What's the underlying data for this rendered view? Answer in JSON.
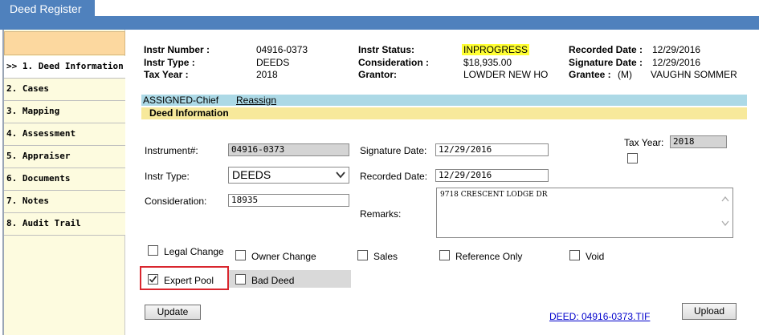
{
  "app": {
    "tab_title": "Deed Register"
  },
  "sidebar": {
    "items": [
      {
        "label": ">> 1. Deed Information"
      },
      {
        "label": "2. Cases"
      },
      {
        "label": "3. Mapping"
      },
      {
        "label": "4. Assessment"
      },
      {
        "label": "5. Appraiser"
      },
      {
        "label": "6. Documents"
      },
      {
        "label": "7. Notes"
      },
      {
        "label": "8. Audit Trail"
      }
    ]
  },
  "summary": {
    "instr_number_label": "Instr Number :",
    "instr_number": "04916-0373",
    "instr_type_label": "Instr Type :",
    "instr_type": "DEEDS",
    "tax_year_label": "Tax Year :",
    "tax_year": "2018",
    "instr_status_label": "Instr Status:",
    "instr_status": "INPROGRESS",
    "consideration_label": "Consideration :",
    "consideration": "$18,935.00",
    "grantor_label": "Grantor:",
    "grantor": "LOWDER NEW HO",
    "recorded_date_label": "Recorded Date :",
    "recorded_date": "12/29/2016",
    "signature_date_label": "Signature Date :",
    "signature_date": "12/29/2016",
    "grantee_label": "Grantee :",
    "grantee_flag": "(M)",
    "grantee": "VAUGHN SOMMER"
  },
  "assignment": {
    "assigned": "ASSIGNED-Chief",
    "reassign": "Reassign"
  },
  "section": {
    "title": "Deed Information"
  },
  "form": {
    "instrument_label": "Instrument#:",
    "instrument_value": "04916-0373",
    "instr_type_label": "Instr Type:",
    "instr_type_value": "DEEDS",
    "consideration_label": "Consideration:",
    "consideration_value": "18935",
    "signature_date_label": "Signature Date:",
    "signature_date_value": "12/29/2016",
    "recorded_date_label": "Recorded Date:",
    "recorded_date_value": "12/29/2016",
    "remarks_label": "Remarks:",
    "remarks_value": "9718 CRESCENT LODGE DR",
    "tax_year_label": "Tax Year:",
    "tax_year_value": "2018"
  },
  "checkboxes": {
    "legal_change": "Legal Change",
    "owner_change": "Owner Change",
    "sales": "Sales",
    "reference_only": "Reference Only",
    "void": "Void",
    "expert_pool": "Expert Pool",
    "bad_deed": "Bad Deed"
  },
  "buttons": {
    "update": "Update",
    "upload": "Upload"
  },
  "document": {
    "link": "DEED: 04916-0373.TIF"
  },
  "colors": {
    "tab_blue": "#4f81bd",
    "highlight": "#ffff33",
    "assign_bar": "#acd9e6",
    "section_bar": "#f7e99b",
    "focus_red": "#d9262e"
  }
}
